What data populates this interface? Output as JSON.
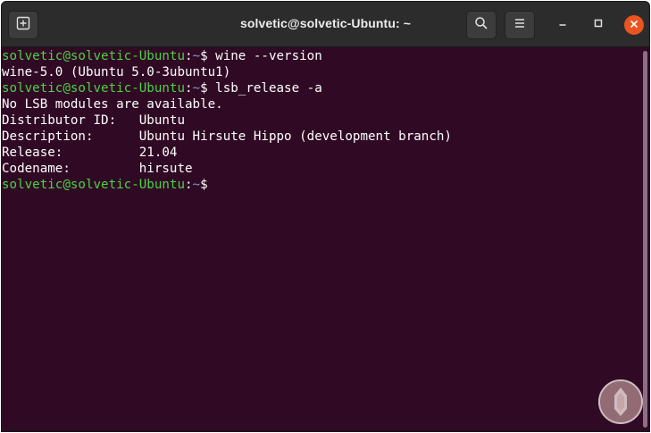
{
  "window": {
    "title": "solvetic@solvetic-Ubuntu: ~"
  },
  "icons": {
    "new_tab": "new-tab-icon",
    "search": "search-icon",
    "menu": "hamburger-menu-icon",
    "minimize": "minimize-icon",
    "maximize": "maximize-icon",
    "close": "close-icon"
  },
  "colors": {
    "terminal_bg": "#300a24",
    "prompt_user": "#4bd344",
    "prompt_path": "#729fcf",
    "close_button": "#e95420"
  },
  "prompt": {
    "user": "solvetic@solvetic-Ubuntu",
    "sep": ":",
    "path": "~",
    "symbol": "$"
  },
  "terminal": {
    "cmd1": " wine --version",
    "out1": "wine-5.0 (Ubuntu 5.0-3ubuntu1)",
    "cmd2": " lsb_release -a",
    "out2": "No LSB modules are available.",
    "out3": "Distributor ID:\tUbuntu",
    "out4": "Description:\tUbuntu Hirsute Hippo (development branch)",
    "out5": "Release:\t21.04",
    "out6": "Codename:\thirsute"
  }
}
